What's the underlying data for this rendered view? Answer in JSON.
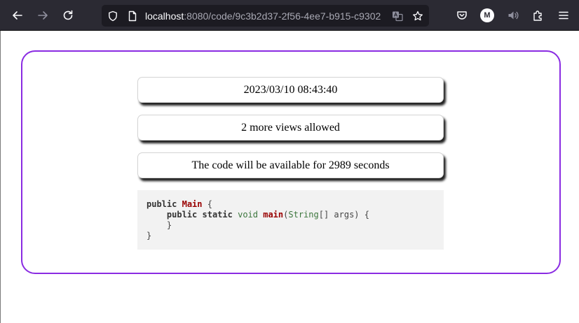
{
  "browser": {
    "url_host": "localhost",
    "url_rest": ":8080/code/9c3b2d37-2f56-4ee7-b915-c9302",
    "avatar_letter": "M",
    "icon_color": "#fbfbfe",
    "toolbar_bg": "#2b2a33"
  },
  "page": {
    "accent_color": "#8a2be2",
    "date": "2023/03/10 08:43:40",
    "views": "2 more views allowed",
    "time": "The code will be available for 2989 seconds"
  },
  "code": {
    "lines": [
      [
        {
          "t": "public",
          "c": "kw"
        },
        {
          "t": " ",
          "c": "pl"
        },
        {
          "t": "Main",
          "c": "fn"
        },
        {
          "t": " {",
          "c": "pl"
        }
      ],
      [
        {
          "t": "    ",
          "c": "pl"
        },
        {
          "t": "public",
          "c": "kw"
        },
        {
          "t": " ",
          "c": "pl"
        },
        {
          "t": "static",
          "c": "kw"
        },
        {
          "t": " ",
          "c": "pl"
        },
        {
          "t": "void",
          "c": "ty"
        },
        {
          "t": " ",
          "c": "pl"
        },
        {
          "t": "main",
          "c": "fn"
        },
        {
          "t": "(",
          "c": "pl"
        },
        {
          "t": "String",
          "c": "ty"
        },
        {
          "t": "[] args) {",
          "c": "pl"
        }
      ],
      [
        {
          "t": "    }",
          "c": "pl"
        }
      ],
      [
        {
          "t": "}",
          "c": "pl"
        }
      ]
    ]
  }
}
